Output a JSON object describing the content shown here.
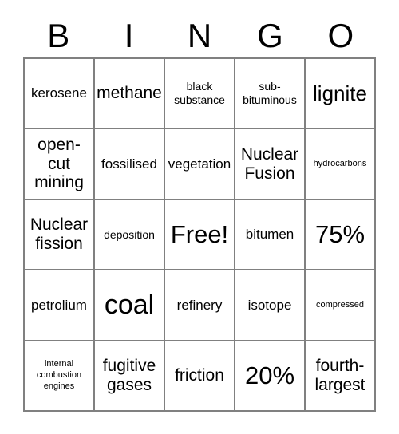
{
  "card": {
    "title": "BINGO",
    "header_letters": [
      "B",
      "I",
      "N",
      "G",
      "O"
    ],
    "border_color": "#808080",
    "background_color": "#ffffff",
    "text_color": "#000000",
    "columns": 5,
    "rows": 5,
    "free_space_label": "Free!",
    "free_space_position": {
      "row": 3,
      "column": 3
    },
    "cells": [
      {
        "text": "kerosene",
        "size": "m"
      },
      {
        "text": "methane",
        "size": "l"
      },
      {
        "text": "black\nsubstance",
        "size": "s"
      },
      {
        "text": "sub-\nbituminous",
        "size": "s"
      },
      {
        "text": "lignite",
        "size": "xl"
      },
      {
        "text": "open-\ncut\nmining",
        "size": "l"
      },
      {
        "text": "fossilised",
        "size": "m"
      },
      {
        "text": "vegetation",
        "size": "m"
      },
      {
        "text": "Nuclear\nFusion",
        "size": "l"
      },
      {
        "text": "hydrocarbons",
        "size": "xs"
      },
      {
        "text": "Nuclear\nfission",
        "size": "l"
      },
      {
        "text": "deposition",
        "size": "s"
      },
      {
        "text": "Free!",
        "size": "xxl"
      },
      {
        "text": "bitumen",
        "size": "m"
      },
      {
        "text": "75%",
        "size": "xxl"
      },
      {
        "text": "petrolium",
        "size": "m"
      },
      {
        "text": "coal",
        "size": "xxxl"
      },
      {
        "text": "refinery",
        "size": "m"
      },
      {
        "text": "isotope",
        "size": "m"
      },
      {
        "text": "compressed",
        "size": "xs"
      },
      {
        "text": "internal\ncombustion\nengines",
        "size": "xs"
      },
      {
        "text": "fugitive\ngases",
        "size": "l"
      },
      {
        "text": "friction",
        "size": "l"
      },
      {
        "text": "20%",
        "size": "xxl"
      },
      {
        "text": "fourth-\nlargest",
        "size": "l"
      }
    ]
  }
}
